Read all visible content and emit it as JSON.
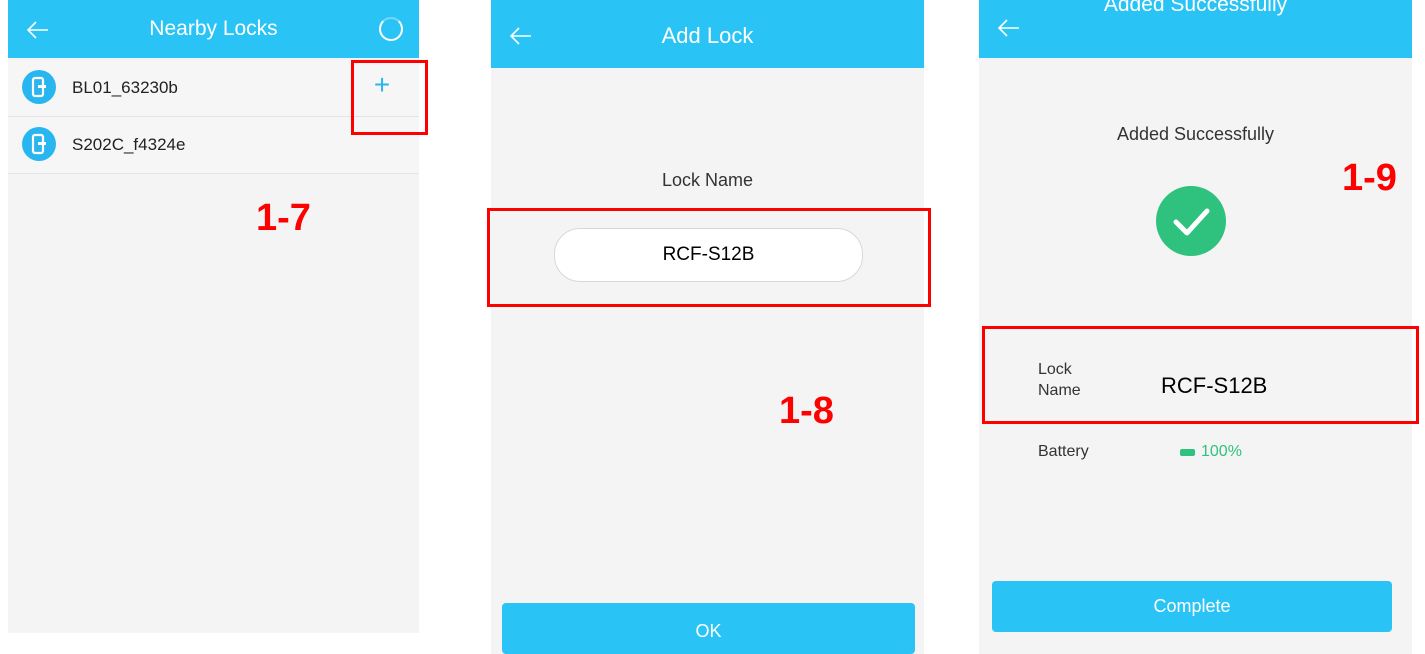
{
  "screen1": {
    "title": "Nearby Locks",
    "locks": [
      {
        "name": "BL01_63230b",
        "action": "+"
      },
      {
        "name": "S202C_f4324e"
      }
    ],
    "step": "1-7"
  },
  "screen2": {
    "title": "Add Lock",
    "field_label": "Lock Name",
    "field_value": "RCF-S12B",
    "ok_label": "OK",
    "step": "1-8"
  },
  "screen3": {
    "title": "Added Successfully",
    "message": "Added Successfully",
    "lock_name_label_1": "Lock",
    "lock_name_label_2": "Name",
    "lock_name_value": "RCF-S12B",
    "battery_label": "Battery",
    "battery_value": "100%",
    "complete_label": "Complete",
    "step": "1-9"
  },
  "colors": {
    "header": "#29c4f5",
    "accent": "#29b6f0",
    "success": "#2ec27e",
    "annotation": "#ff0000"
  }
}
